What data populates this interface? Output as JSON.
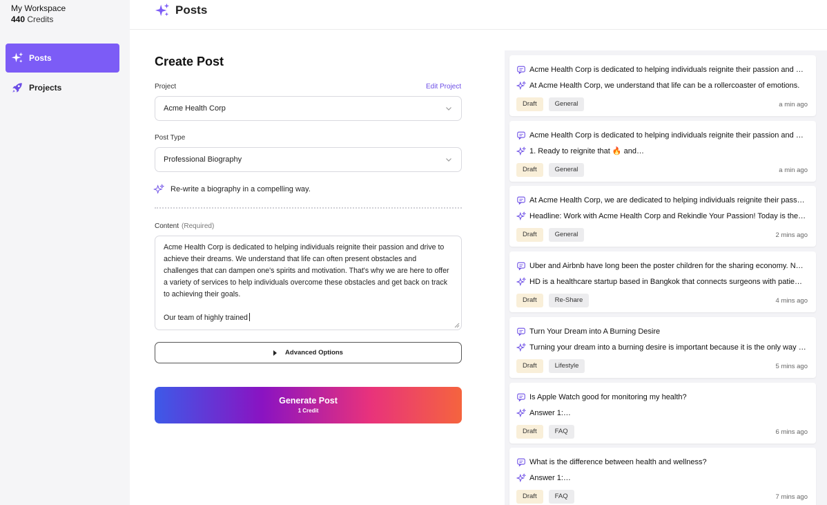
{
  "workspace": {
    "name": "My Workspace",
    "credits_count": "440",
    "credits_label": "Credits"
  },
  "nav": {
    "posts_label": "Posts",
    "projects_label": "Projects"
  },
  "header": {
    "title": "Posts"
  },
  "form": {
    "title": "Create Post",
    "project_label": "Project",
    "edit_project": "Edit Project",
    "project_value": "Acme Health Corp",
    "post_type_label": "Post Type",
    "post_type_value": "Professional Biography",
    "hint": "Re-write a biography in a compelling way.",
    "content_label": "Content",
    "content_required": "(Required)",
    "content_value": "Acme Health Corp is dedicated to helping individuals reignite their passion and drive to achieve their dreams. We understand that life can often present obstacles and challenges that can dampen one's spirits and motivation. That's why we are here to offer a variety of services to help individuals overcome these obstacles and get back on track to achieving their goals.\n\nOur team of highly trained",
    "advanced_options": "Advanced Options",
    "generate_label": "Generate Post",
    "generate_cost": "1 Credit"
  },
  "posts": [
    {
      "title": "Acme Health Corp is dedicated to helping individuals reignite their passion and drive to achieve their dreams.",
      "summary": "At Acme Health Corp, we understand that life can be a rollercoaster of emotions.",
      "status": "Draft",
      "category": "General",
      "time": "a min ago"
    },
    {
      "title": "Acme Health Corp is dedicated to helping individuals reignite their passion and drive to achieve their dreams.",
      "summary": "1. Ready to reignite that 🔥 and…",
      "status": "Draft",
      "category": "General",
      "time": "a min ago"
    },
    {
      "title": "At Acme Health Corp, we are dedicated to helping individuals reignite their passion and drive.",
      "summary": "Headline: Work with Acme Health Corp and Rekindle Your Passion! Today is the day.",
      "status": "Draft",
      "category": "General",
      "time": "2 mins ago"
    },
    {
      "title": "Uber and Airbnb have long been the poster children for the sharing economy. Now it is time.",
      "summary": "HD is a healthcare startup based in Bangkok that connects surgeons with patients.",
      "status": "Draft",
      "category": "Re-Share",
      "time": "4 mins ago"
    },
    {
      "title": "Turn Your Dream into A Burning Desire",
      "summary": "Turning your dream into a burning desire is important because it is the only way forward.",
      "status": "Draft",
      "category": "Lifestyle",
      "time": "5 mins ago"
    },
    {
      "title": "Is Apple Watch good for monitoring my health?",
      "summary": "Answer 1:…",
      "status": "Draft",
      "category": "FAQ",
      "time": "6 mins ago"
    },
    {
      "title": "What is the difference between health and wellness?",
      "summary": "Answer 1:…",
      "status": "Draft",
      "category": "FAQ",
      "time": "7 mins ago"
    }
  ],
  "colors": {
    "accent": "#7c5cf6",
    "draft_tag": "#f9efd9",
    "category_tag": "#ececee",
    "link": "#6b4ce6"
  },
  "icons": {
    "posts": "sparkles-icon",
    "projects": "rocket-icon",
    "post_title": "chat-bubble-icon",
    "post_summary": "sparkles-icon",
    "select": "chevron-down-icon"
  }
}
